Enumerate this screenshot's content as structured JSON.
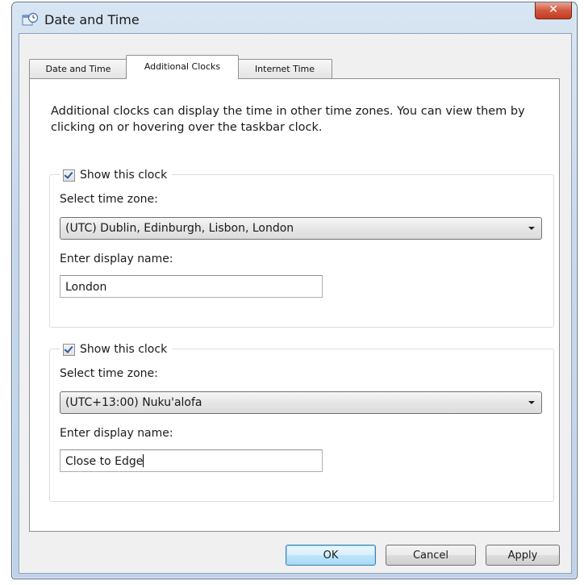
{
  "window": {
    "title": "Date and Time",
    "close_glyph": "✕"
  },
  "tabs": [
    {
      "label": "Date and Time",
      "active": false
    },
    {
      "label": "Additional Clocks",
      "active": true
    },
    {
      "label": "Internet Time",
      "active": false
    }
  ],
  "description": "Additional clocks can display the time in other time zones. You can view them by clicking on or hovering over the taskbar clock.",
  "clocks": [
    {
      "show_label": "Show this clock",
      "checked": true,
      "timezone_label": "Select time zone:",
      "timezone_value": "(UTC) Dublin, Edinburgh, Lisbon, London",
      "display_name_label": "Enter display name:",
      "display_name_value": "London"
    },
    {
      "show_label": "Show this clock",
      "checked": true,
      "timezone_label": "Select time zone:",
      "timezone_value": "(UTC+13:00) Nuku'alofa",
      "display_name_label": "Enter display name:",
      "display_name_value": "Close to Edge"
    }
  ],
  "buttons": {
    "ok": "OK",
    "cancel": "Cancel",
    "apply": "Apply"
  },
  "icons": {
    "app_icon": "date-time-clock-icon",
    "close": "close-icon",
    "dropdown": "chevron-down-icon",
    "check": "checkmark-icon"
  }
}
